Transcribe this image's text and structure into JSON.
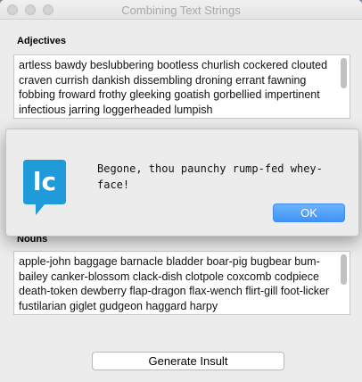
{
  "window": {
    "title": "Combining Text Strings"
  },
  "adjectives": {
    "label": "Adjectives",
    "text": "artless bawdy beslubbering bootless churlish cockered clouted craven currish dankish dissembling droning errant fawning fobbing froward frothy gleeking goatish gorbellied impertinent infectious jarring loggerheaded lumpish"
  },
  "nouns": {
    "label": "Nouns",
    "text": "apple-john baggage barnacle bladder boar-pig bugbear bum-bailey canker-blossom clack-dish clotpole coxcomb codpiece death-token dewberry flap-dragon flax-wench flirt-gill foot-licker fustilarian giglet gudgeon haggard harpy"
  },
  "dialog": {
    "message": "Begone, thou paunchy rump-fed whey-face!",
    "ok_label": "OK",
    "icon_text": "lc"
  },
  "actions": {
    "generate_label": "Generate Insult"
  },
  "colors": {
    "accent": "#3e93f8",
    "icon_blue": "#1f9bd9"
  }
}
